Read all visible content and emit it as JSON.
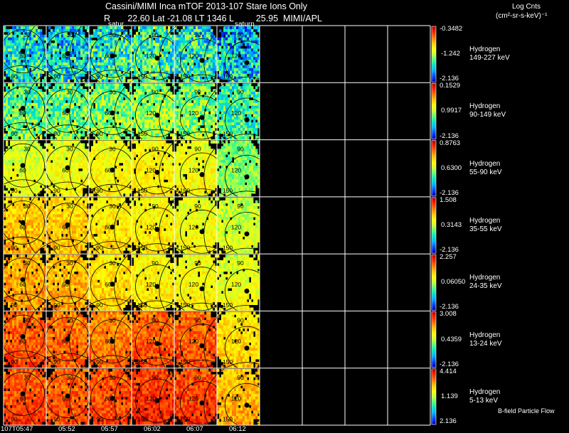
{
  "header": {
    "title_line1": "Cassini/MIMI Inca mTOF  2013-107   Stare   Ions Only",
    "title_line2": "R       22.60 Lat -21.08 LT 1346 L         25.95  MIMI/APL",
    "saturn_label": "satur",
    "saturn_label2": "saturn",
    "units_line1": "Log Cnts",
    "units_line2": "(cm²-sr-s-keV)⁻¹"
  },
  "footer": {
    "bfield_label": "B-field Particle Flow"
  },
  "chart_data": {
    "type": "heatmap",
    "time_ticks": [
      "107T05:47",
      "05:52",
      "05:57",
      "06:02",
      "06:07",
      "06:12"
    ],
    "columns_total": 10,
    "columns_with_data": 6,
    "contour_labels": [
      "30",
      "60",
      "90",
      "120",
      "150"
    ],
    "colormap": [
      "#0000c8",
      "#0050ff",
      "#00b4ff",
      "#00e6c8",
      "#50ff78",
      "#c8ff32",
      "#ffff00",
      "#ffc800",
      "#ff7800",
      "#ff2800",
      "#c80000"
    ],
    "rows": [
      {
        "species": "Hydrogen",
        "energy": "149-227 keV",
        "cmax": "-0.3482",
        "cmid": "-1.242",
        "cmin": "-2.136",
        "level": [
          0.3,
          0.28,
          0.33,
          0.35,
          0.32,
          0.24
        ]
      },
      {
        "species": "Hydrogen",
        "energy": "90-149 keV",
        "cmax": "0.1529",
        "cmid": "0.9917",
        "cmin": "-2.136",
        "level": [
          0.4,
          0.42,
          0.44,
          0.46,
          0.44,
          0.36
        ]
      },
      {
        "species": "Hydrogen",
        "energy": "55-90 keV",
        "cmax": "0.8763",
        "cmid": "0.6300",
        "cmin": "-2.136",
        "level": [
          0.55,
          0.58,
          0.6,
          0.62,
          0.58,
          0.44
        ]
      },
      {
        "species": "Hydrogen",
        "energy": "35-55 keV",
        "cmax": "1.508",
        "cmid": "0.3143",
        "cmin": "-2.136",
        "level": [
          0.7,
          0.68,
          0.64,
          0.62,
          0.58,
          0.52
        ]
      },
      {
        "species": "Hydrogen",
        "energy": "24-35 keV",
        "cmax": "2.257",
        "cmid": "0.06050",
        "cmin": "-2.136",
        "level": [
          0.74,
          0.72,
          0.66,
          0.62,
          0.6,
          0.56
        ]
      },
      {
        "species": "Hydrogen",
        "energy": "13-24 keV",
        "cmax": "3.008",
        "cmid": "0.4359",
        "cmin": "-2.136",
        "level": [
          0.84,
          0.82,
          0.8,
          0.84,
          0.84,
          0.66
        ]
      },
      {
        "species": "Hydrogen",
        "energy": "5-13 keV",
        "cmax": "4.414",
        "cmid": "1.139",
        "cmin": "2.136",
        "level": [
          0.86,
          0.84,
          0.86,
          0.9,
          0.88,
          0.72
        ]
      }
    ]
  }
}
